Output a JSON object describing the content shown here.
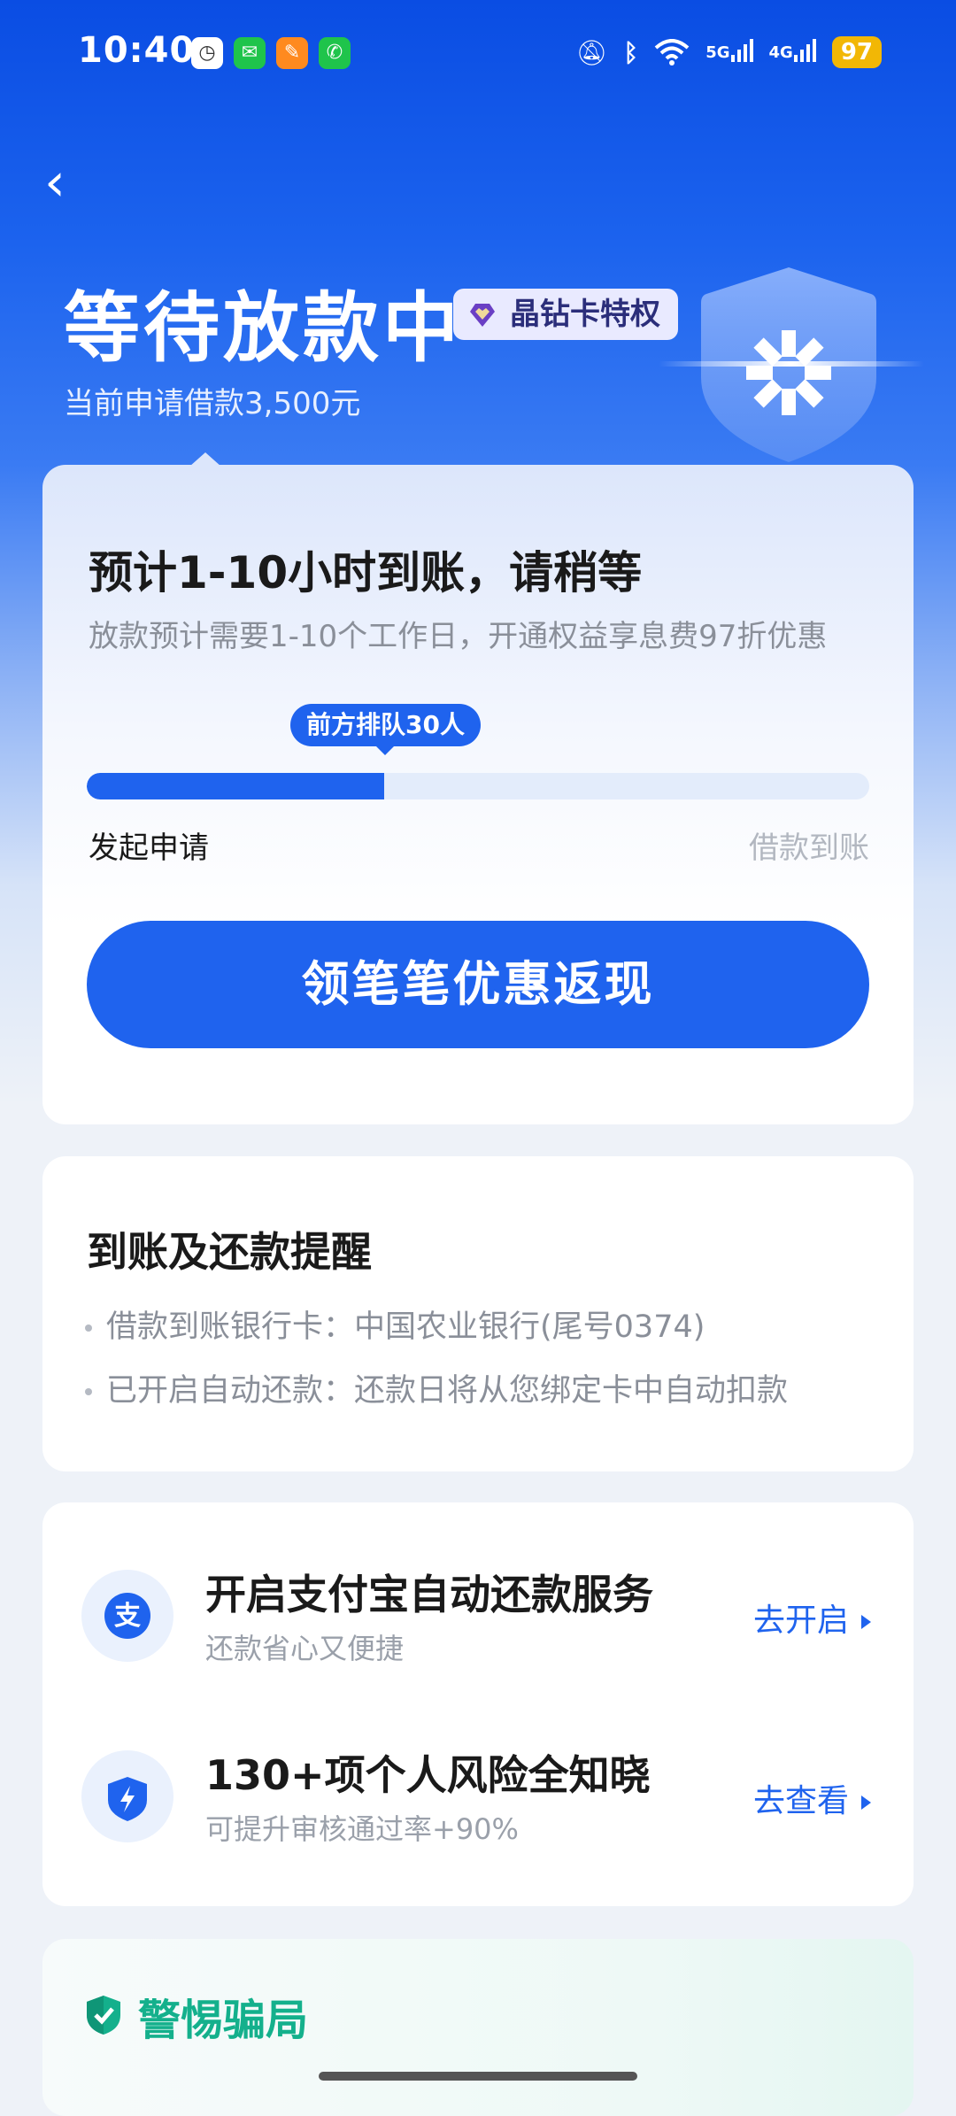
{
  "status_bar": {
    "time": "10:40",
    "signal_1": "5G",
    "signal_2": "4G",
    "battery": "97"
  },
  "header": {
    "back_icon": "chevron-left",
    "title": "等待放款中",
    "vip_badge": "晶钻卡特权",
    "subtitle": "当前申请借款3,500元"
  },
  "status_card": {
    "title": "预计1-10小时到账，请稍等",
    "description": "放款预计需要1-10个工作日，开通权益享息费97折优惠",
    "queue_tip": "前方排队30人",
    "progress_fraction": 0.38,
    "progress_start_label": "发起申请",
    "progress_end_label": "借款到账",
    "cta_label": "领笔笔优惠返现"
  },
  "reminder_card": {
    "title": "到账及还款提醒",
    "items": [
      "借款到账银行卡：中国农业银行(尾号0374)",
      "已开启自动还款：还款日将从您绑定卡中自动扣款"
    ]
  },
  "services": [
    {
      "icon": "alipay-icon",
      "title": "开启支付宝自动还款服务",
      "subtitle": "还款省心又便捷",
      "action": "去开启"
    },
    {
      "icon": "shield-bolt-icon",
      "title": "130+项个人风险全知晓",
      "subtitle": "可提升审核通过率+90%",
      "action": "去查看"
    }
  ],
  "fraud_card": {
    "title": "警惕骗局"
  },
  "colors": {
    "primary": "#1f63ee",
    "fraud_green": "#14b08c",
    "battery": "#f2b705"
  }
}
